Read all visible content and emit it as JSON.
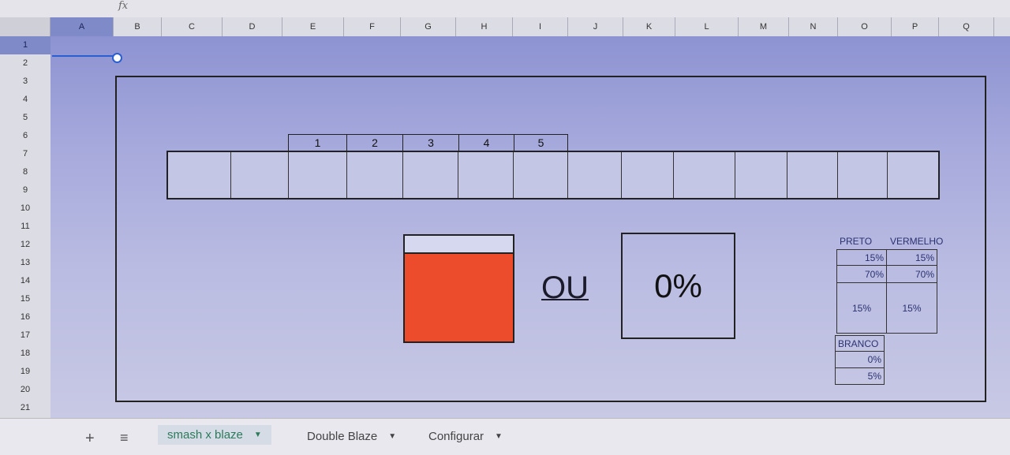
{
  "toolbar": {
    "fx_icon": "fx"
  },
  "columns": [
    "A",
    "B",
    "C",
    "D",
    "E",
    "F",
    "G",
    "H",
    "I",
    "J",
    "K",
    "L",
    "M",
    "N",
    "O",
    "P",
    "Q"
  ],
  "rows": [
    "1",
    "2",
    "3",
    "4",
    "5",
    "6",
    "7",
    "8",
    "9",
    "10",
    "11",
    "12",
    "13",
    "14",
    "15",
    "16",
    "17",
    "18",
    "19",
    "20",
    "21"
  ],
  "sheet": {
    "number_headers": [
      "1",
      "2",
      "3",
      "4",
      "5"
    ],
    "result_fill": 0.83,
    "result_color": "#ec4b2c",
    "ou_label": "OU",
    "percentage": "0%",
    "stats": {
      "preto_label": "PRETO",
      "vermelho_label": "VERMELHO",
      "rows": [
        {
          "preto": "15%",
          "vermelho": "15%"
        },
        {
          "preto": "70%",
          "vermelho": "70%"
        },
        {
          "preto": "15%",
          "vermelho": "15%"
        }
      ],
      "branco_label": "BRANCO",
      "branco_values": [
        "0%",
        "5%"
      ]
    }
  },
  "tabs": [
    {
      "label": "smash x blaze",
      "active": true
    },
    {
      "label": "Double Blaze",
      "active": false
    },
    {
      "label": "Configurar",
      "active": false
    }
  ],
  "bottom": {
    "add_icon": "+",
    "menu_icon": "≡"
  },
  "colors": {
    "selection": "#2a5fd1",
    "accent_tab": "#2c7a5a"
  }
}
